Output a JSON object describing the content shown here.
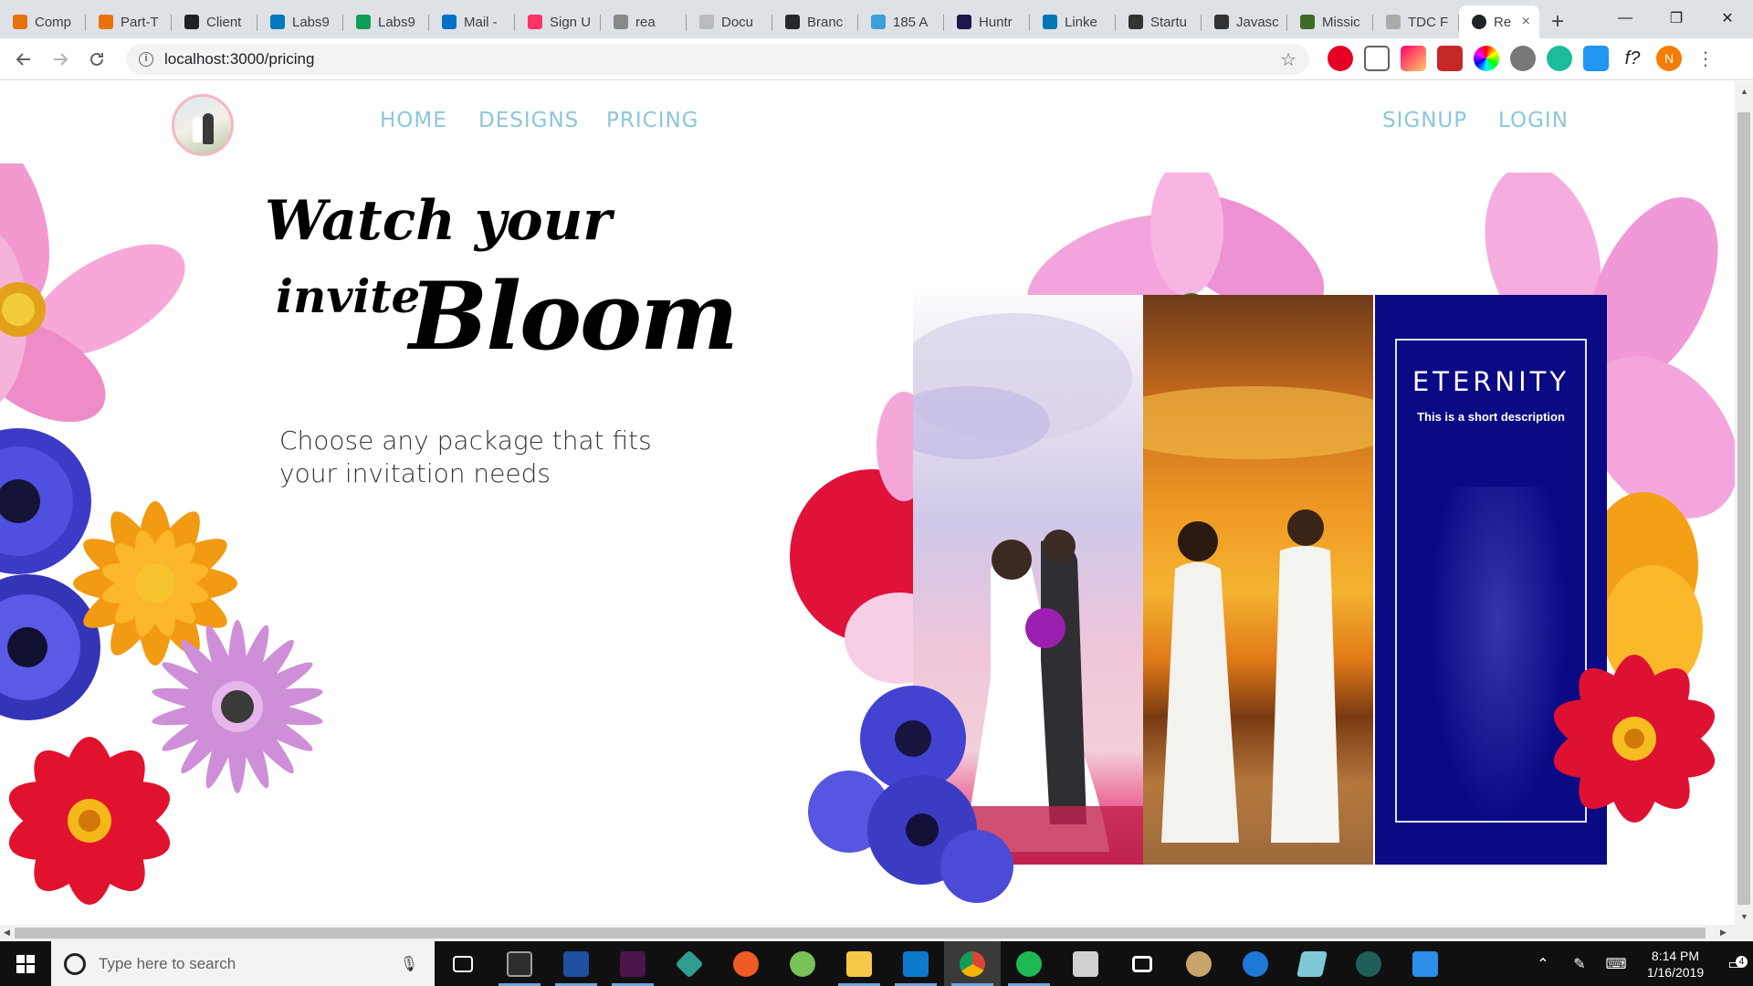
{
  "browser": {
    "tabs": [
      {
        "title": "Comp",
        "color": "#e8710a"
      },
      {
        "title": "Part-T",
        "color": "#e8710a"
      },
      {
        "title": "Client",
        "color": "#202124"
      },
      {
        "title": "Labs9",
        "color": "#0079bf"
      },
      {
        "title": "Labs9",
        "color": "#0f9d58"
      },
      {
        "title": "Mail -",
        "color": "#0072c6"
      },
      {
        "title": "Sign U",
        "color": "#ff3366"
      },
      {
        "title": "rea",
        "color": "#888888"
      },
      {
        "title": "Docu",
        "color": "#bbbbbb"
      },
      {
        "title": "Branc",
        "color": "#24292e"
      },
      {
        "title": "185 A",
        "color": "#3ba0d8"
      },
      {
        "title": "Huntr",
        "color": "#1a1a4e"
      },
      {
        "title": "Linke",
        "color": "#0077b5"
      },
      {
        "title": "Startu",
        "color": "#333333"
      },
      {
        "title": "Javasc",
        "color": "#333333"
      },
      {
        "title": "Missic",
        "color": "#3b6e22"
      },
      {
        "title": "TDC F",
        "color": "#aaaaaa"
      }
    ],
    "active_tab": {
      "title": "Re",
      "close": "×"
    },
    "new_tab": "+",
    "url": "localhost:3000/pricing",
    "window_controls": {
      "minimize": "—",
      "maximize": "❐",
      "close": "✕"
    }
  },
  "nav": {
    "home": "HOME",
    "designs": "DESIGNS",
    "pricing": "PRICING",
    "signup": "SIGNUP",
    "login": "LOGIN"
  },
  "hero": {
    "line1": "Watch your",
    "line2a": "invite",
    "line2b": "Bloom",
    "subtitle": "Choose any package that fits your invitation needs"
  },
  "cards": {
    "featured": {
      "title": "ETERNITY",
      "description": "This is a short description"
    }
  },
  "taskbar": {
    "search_placeholder": "Type here to search",
    "time": "8:14 PM",
    "date": "1/16/2019",
    "notifications": "4"
  },
  "colors": {
    "nav_link": "#8cc6dc",
    "card_blue": "#0a0a84"
  }
}
